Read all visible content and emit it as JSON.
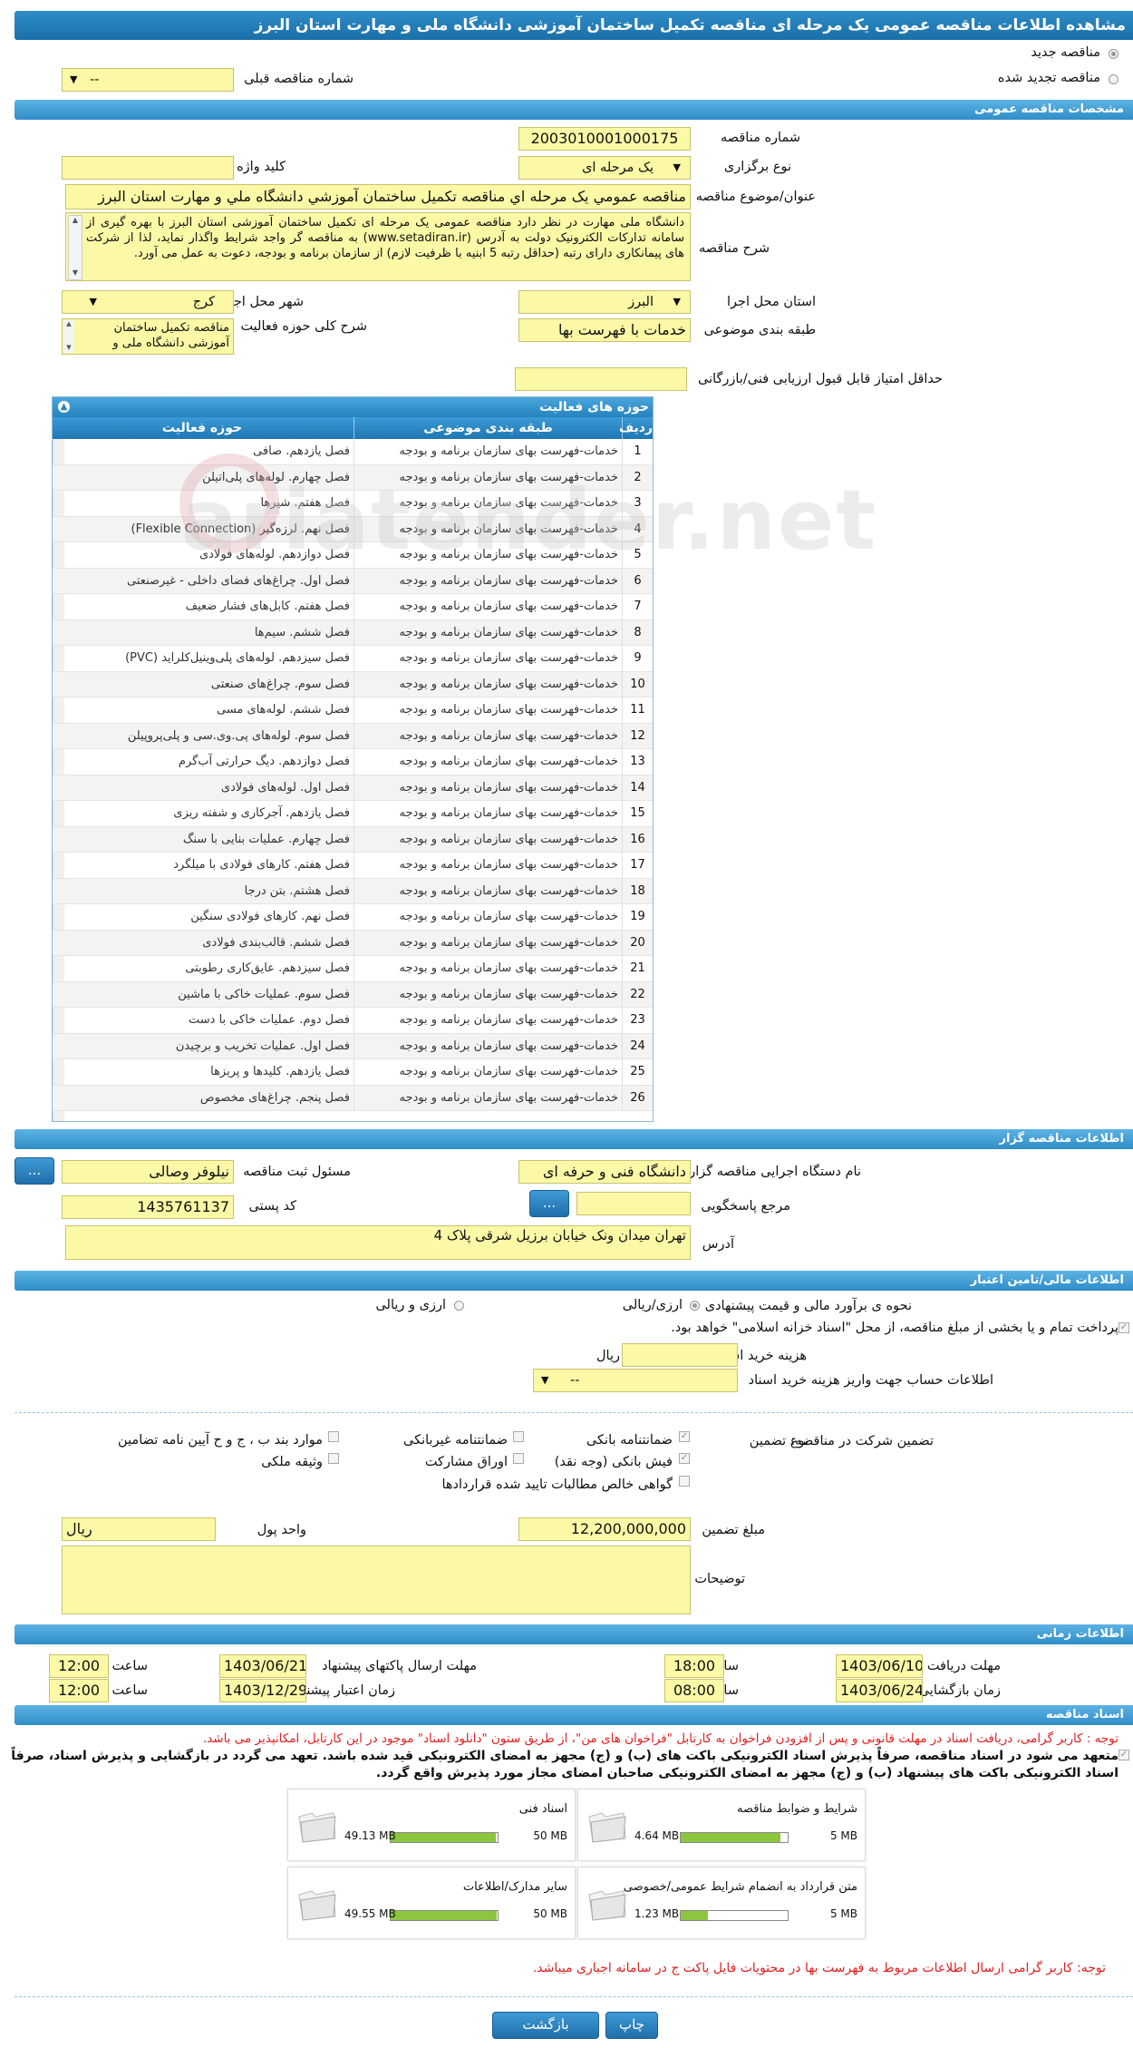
{
  "page": {
    "title": "مشاهده اطلاعات مناقصه عمومی یک مرحله ای مناقصه تکمیل ساختمان آموزشی دانشگاه ملی و مهارت استان البرز"
  },
  "top": {
    "radio_new": "مناقصه جدید",
    "radio_renewed": "مناقصه تجدید شده",
    "prev_tender_label": "شماره مناقصه قبلی",
    "prev_tender_value": "--"
  },
  "general": {
    "section_title": "مشخصات مناقصه عمومی",
    "tender_no_label": "شماره مناقصه",
    "tender_no": "2003010001000175",
    "type_label": "نوع برگزاری",
    "type_value": "یک مرحله ای",
    "keyword_label": "کلید واژه",
    "keyword_value": "",
    "subject_label": "عنوان/موضوع مناقصه",
    "subject_value": "مناقصه عمومي يک مرحله اي مناقصه تکميل ساختمان آموزشي دانشگاه ملي و مهارت استان البرز",
    "desc_label": "شرح مناقصه",
    "desc_value": "دانشگاه ملی مهارت در نظر دارد مناقصه عمومی یک مرحله ای تکمیل ساختمان آموزشی استان البرز با بهره گیری از سامانه تدارکات الکترونیک دولت به آدرس (www.setadiran.ir) به مناقصه گر واجد شرایط واگذار نماید، لذا از شرکت های پیمانکاری دارای رتبه (حداقل رتبه 5 ابنیه با ظرفیت لازم) از سازمان برنامه و بودجه، دعوت به عمل می آورد.",
    "province_label": "استان محل اجرا",
    "province_value": "البرز",
    "city_label": "شهر محل اجرا",
    "city_value": "کرج",
    "category_label": "طبقه بندی موضوعی",
    "category_value": "خدمات با فهرست بها",
    "scope_label": "شرح کلی حوزه فعالیت",
    "scope_value": "مناقصه تکمیل ساختمان آموزشی دانشگاه ملی و",
    "min_score_label": "حداقل امتیاز قابل قبول ارزیابی فنی/بازرگانی",
    "min_score_value": ""
  },
  "activities": {
    "title": "حوزه های فعالیت",
    "col_idx": "ردیف",
    "col_category": "طبقه بندی موضوعی",
    "col_activity": "حوزه فعالیت",
    "rows": [
      {
        "idx": "1",
        "category": "خدمات-فهرست بهای سازمان برنامه و بودجه",
        "activity": "فصل یازدهم. صافی"
      },
      {
        "idx": "2",
        "category": "خدمات-فهرست بهای سازمان برنامه و بودجه",
        "activity": "فصل چهارم. لوله‌های پلی‌اتیلن"
      },
      {
        "idx": "3",
        "category": "خدمات-فهرست بهای سازمان برنامه و بودجه",
        "activity": "فصل هفتم. شیرها"
      },
      {
        "idx": "4",
        "category": "خدمات-فهرست بهای سازمان برنامه و بودجه",
        "activity": "فصل نهم. لرزه‌گیر (Flexible Connection)"
      },
      {
        "idx": "5",
        "category": "خدمات-فهرست بهای سازمان برنامه و بودجه",
        "activity": "فصل دوازدهم. لوله‌های فولادی"
      },
      {
        "idx": "6",
        "category": "خدمات-فهرست بهای سازمان برنامه و بودجه",
        "activity": "فصل اول. چراغ‌های فضای داخلی - غیرصنعتی"
      },
      {
        "idx": "7",
        "category": "خدمات-فهرست بهای سازمان برنامه و بودجه",
        "activity": "فصل هفتم. کابل‌های فشار ضعیف"
      },
      {
        "idx": "8",
        "category": "خدمات-فهرست بهای سازمان برنامه و بودجه",
        "activity": "فصل ششم. سیم‌ها"
      },
      {
        "idx": "9",
        "category": "خدمات-فهرست بهای سازمان برنامه و بودجه",
        "activity": "فصل سیزدهم. لوله‌های پلی‌وینیل‌کلراید (PVC)"
      },
      {
        "idx": "10",
        "category": "خدمات-فهرست بهای سازمان برنامه و بودجه",
        "activity": "فصل سوم. چراغ‌های صنعتی"
      },
      {
        "idx": "11",
        "category": "خدمات-فهرست بهای سازمان برنامه و بودجه",
        "activity": "فصل ششم. لوله‌های مسی"
      },
      {
        "idx": "12",
        "category": "خدمات-فهرست بهای سازمان برنامه و بودجه",
        "activity": "فصل سوم. لوله‌های پی.وی.سی و پلی‌پروپیلن"
      },
      {
        "idx": "13",
        "category": "خدمات-فهرست بهای سازمان برنامه و بودجه",
        "activity": "فصل دوازدهم. دیگ حرارتی آب‌گرم"
      },
      {
        "idx": "14",
        "category": "خدمات-فهرست بهای سازمان برنامه و بودجه",
        "activity": "فصل اول. لوله‌های فولادی"
      },
      {
        "idx": "15",
        "category": "خدمات-فهرست بهای سازمان برنامه و بودجه",
        "activity": "فصل یازدهم. آجرکاری و شفته ریزی"
      },
      {
        "idx": "16",
        "category": "خدمات-فهرست بهای سازمان برنامه و بودجه",
        "activity": "فصل چهارم. عملیات بنایی با سنگ"
      },
      {
        "idx": "17",
        "category": "خدمات-فهرست بهای سازمان برنامه و بودجه",
        "activity": "فصل هفتم. کارهای فولادی با میلگرد"
      },
      {
        "idx": "18",
        "category": "خدمات-فهرست بهای سازمان برنامه و بودجه",
        "activity": "فصل هشتم. بتن درجا"
      },
      {
        "idx": "19",
        "category": "خدمات-فهرست بهای سازمان برنامه و بودجه",
        "activity": "فصل نهم. کارهای فولادی سنگین"
      },
      {
        "idx": "20",
        "category": "خدمات-فهرست بهای سازمان برنامه و بودجه",
        "activity": "فصل ششم. قالب‌بندی فولادی"
      },
      {
        "idx": "21",
        "category": "خدمات-فهرست بهای سازمان برنامه و بودجه",
        "activity": "فصل سیزدهم. عایق‌کاری رطوبتی"
      },
      {
        "idx": "22",
        "category": "خدمات-فهرست بهای سازمان برنامه و بودجه",
        "activity": "فصل سوم. عملیات خاکی با ماشین"
      },
      {
        "idx": "23",
        "category": "خدمات-فهرست بهای سازمان برنامه و بودجه",
        "activity": "فصل دوم. عملیات خاکی با دست"
      },
      {
        "idx": "24",
        "category": "خدمات-فهرست بهای سازمان برنامه و بودجه",
        "activity": "فصل اول. عملیات تخریب و برچیدن"
      },
      {
        "idx": "25",
        "category": "خدمات-فهرست بهای سازمان برنامه و بودجه",
        "activity": "فصل یازدهم. کلیدها و پریزها"
      },
      {
        "idx": "26",
        "category": "خدمات-فهرست بهای سازمان برنامه و بودجه",
        "activity": "فصل پنجم. چراغ‌های مخصوص"
      }
    ]
  },
  "organizer": {
    "section_title": "اطلاعات مناقصه گزار",
    "org_label": "نام دستگاه اجرایی مناقصه گزار",
    "org_value": "دانشگاه فنی و حرفه ای",
    "registrar_label": "مسئول ثبت مناقصه",
    "registrar_value": "نیلوفر وصالی",
    "ref_label": "مرجع پاسخگویی",
    "ref_value": "",
    "postal_label": "کد پستی",
    "postal_value": "1435761137",
    "address_label": "آدرس",
    "address_value": "تهران میدان ونک خیابان برزیل شرقی پلاک 4",
    "more_btn": "..."
  },
  "finance": {
    "section_title": "اطلاعات مالی/تامین اعتبار",
    "estimate_label": "نحوه ی برآورد مالی و قیمت پیشنهادی",
    "opt_rial_fx": "ارزی/ریالی",
    "opt_fx_and_rial": "ارزی و ریالی",
    "islamic_note": "پرداخت تمام و یا بخشی از مبلغ مناقصه، از محل \"اسناد خزانه اسلامی\" خواهد بود.",
    "doc_cost_label": "هزینه خرید اسناد",
    "doc_cost_value": "",
    "doc_cost_unit": "ریال",
    "account_label": "اطلاعات حساب جهت واریز هزینه خرید اسناد",
    "account_value": "--"
  },
  "guarantee": {
    "title": "تضمین شرکت در مناقصه:",
    "type_label": "نوع تضمین",
    "opt_bank": "ضمانتنامه بانکی",
    "opt_nonbank": "ضمانتنامه غیربانکی",
    "opt_items": "موارد بند ب ، ج و ح آیین نامه تضامین",
    "opt_cash": "فیش بانکی (وجه نقد)",
    "opt_bonds": "اوراق مشارکت",
    "opt_property": "وثیقه ملکی",
    "opt_claims": "گواهی خالص مطالبات تایید شده قراردادها",
    "amount_label": "مبلغ تضمین",
    "amount_value": "12,200,000,000",
    "currency_label": "واحد پول",
    "currency_value": "ریال",
    "notes_label": "توضیحات",
    "notes_value": ""
  },
  "timing": {
    "section_title": "اطلاعات زمانی",
    "doc_deadline_label": "مهلت دریافت اسناد",
    "doc_deadline_date": "1403/06/10",
    "doc_deadline_time": "18:00",
    "send_deadline_label": "مهلت ارسال پاکتهای پیشنهاد",
    "send_deadline_date": "1403/06/21",
    "send_deadline_time": "12:00",
    "opening_label": "زمان بازگشایی پاکت ها",
    "opening_date": "1403/06/24",
    "opening_time": "08:00",
    "validity_label": "زمان اعتبار پیشنهاد",
    "validity_date": "1403/12/29",
    "validity_time": "12:00",
    "time_label": "ساعت"
  },
  "documents": {
    "section_title": "اسناد مناقصه",
    "notice_red": "توجه : کاربر گرامی، دریافت اسناد در مهلت قانونی و پس از افزودن فراخوان به کارتابل \"فراخوان های من\"، از طریق ستون \"دانلود اسناد\" موجود در این کارتابل، امکانپذیر می باشد.",
    "commit_line1": "متعهد می شود در اسناد مناقصه، صرفاً پذیرش اسناد الکترونیکی باکت های (ب) و (ج) مجهز به امضای الکترونیکی قید شده باشد. تعهد می گردد در بازگشایی و پذیرش اسناد، صرفاً اسناد الکترونیکی باکت های پیشنهاد (ب) و (ج) مجهز به امضای الکترونیکی صاحبان امضای مجاز مورد پذیرش واقع گردد.",
    "tiles": [
      {
        "name": "شرایط و ضوابط مناقصه",
        "max": "5 MB",
        "size": "4.64 MB",
        "fill": 0.93
      },
      {
        "name": "اسناد فنی",
        "max": "50 MB",
        "size": "49.13 MB",
        "fill": 0.98
      },
      {
        "name": "متن قرارداد به انضمام شرایط عمومی/خصوصی",
        "max": "5 MB",
        "size": "1.23 MB",
        "fill": 0.25
      },
      {
        "name": "سایر مدارک/اطلاعات",
        "max": "50 MB",
        "size": "49.55 MB",
        "fill": 0.99
      }
    ],
    "footer_note": "توجه: کاربر گرامی ارسال اطلاعات مربوط به فهرست بها در محتویات فایل پاکت ج در سامانه اجباری میباشد."
  },
  "actions": {
    "print": "چاپ",
    "back": "بازگشت"
  },
  "colors": {
    "header_blue": "#1a6fa8",
    "field_yellow": "#fbf8a6",
    "progress_green": "#8cc63f",
    "notice_red": "#e02020"
  }
}
